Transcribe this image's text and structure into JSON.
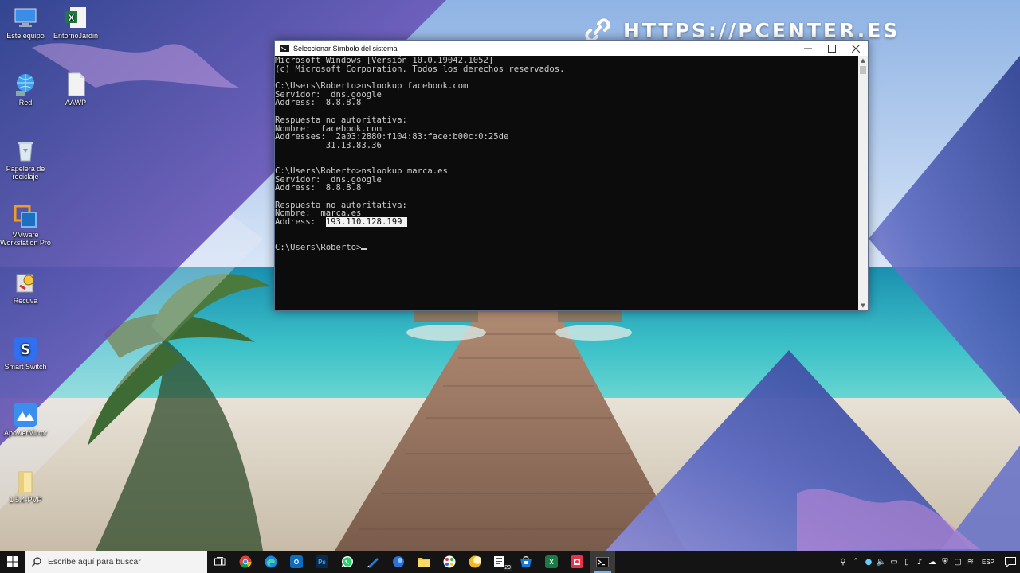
{
  "watermark": {
    "text": "HTTPS://PCENTER.ES"
  },
  "desktop_icons": [
    {
      "label": "Este equipo",
      "icon": "pc-icon"
    },
    {
      "label": "EntornoJardin",
      "icon": "excel-file-icon"
    },
    {
      "label": "Red",
      "icon": "network-icon"
    },
    {
      "label": "AAWP",
      "icon": "file-icon"
    },
    {
      "label": "Papelera de reciclaje",
      "icon": "recycle-bin-icon"
    },
    {
      "label": "VMware Workstation Pro",
      "icon": "vmware-icon"
    },
    {
      "label": "Recuva",
      "icon": "recuva-icon"
    },
    {
      "label": "Smart Switch",
      "icon": "smart-switch-icon"
    },
    {
      "label": "ApowerMirror",
      "icon": "apowermirror-icon"
    },
    {
      "label": "1.5.4-PVP",
      "icon": "folder-icon"
    }
  ],
  "cmd": {
    "title": "Seleccionar Símbolo del sistema",
    "lines": [
      "Microsoft Windows [Versión 10.0.19042.1052]",
      "(c) Microsoft Corporation. Todos los derechos reservados.",
      "",
      "C:\\Users\\Roberto>nslookup facebook.com",
      "Servidor:  dns.google",
      "Address:  8.8.8.8",
      "",
      "Respuesta no autoritativa:",
      "Nombre:  facebook.com",
      "Addresses:  2a03:2880:f104:83:face:b00c:0:25de",
      "          31.13.83.36",
      "",
      "",
      "C:\\Users\\Roberto>nslookup marca.es",
      "Servidor:  dns.google",
      "Address:  8.8.8.8",
      "",
      "Respuesta no autoritativa:",
      "Nombre:  marca.es"
    ],
    "address_label": "Address:  ",
    "selected_address": "193.110.128.199 ",
    "prompt": "C:\\Users\\Roberto>"
  },
  "taskbar": {
    "search_placeholder": "Escribe aquí para buscar",
    "apps": [
      {
        "name": "task-view-button",
        "icon": "task-view-icon"
      },
      {
        "name": "chrome-button",
        "icon": "chrome-icon"
      },
      {
        "name": "edge-button",
        "icon": "edge-icon"
      },
      {
        "name": "outlook-button",
        "icon": "outlook-icon",
        "text": "O",
        "color": "#0f6cbd"
      },
      {
        "name": "photoshop-button",
        "icon": "photoshop-icon",
        "text": "Ps",
        "color": "#0b2a4a"
      },
      {
        "name": "whatsapp-button",
        "icon": "whatsapp-icon"
      },
      {
        "name": "pen-app-button",
        "icon": "pen-icon"
      },
      {
        "name": "browser-button",
        "icon": "globe-icon"
      },
      {
        "name": "file-explorer-button",
        "icon": "folder-icon"
      },
      {
        "name": "paint-button",
        "icon": "palette-icon"
      },
      {
        "name": "app-button",
        "icon": "moon-icon"
      },
      {
        "name": "calendar-button",
        "icon": "calendar-icon",
        "badge": "29"
      },
      {
        "name": "store-button",
        "icon": "store-icon"
      },
      {
        "name": "excel-button",
        "icon": "excel-icon",
        "text": "X",
        "color": "#1e7a45"
      },
      {
        "name": "media-button",
        "icon": "media-icon"
      },
      {
        "name": "cmd-button",
        "icon": "cmd-icon"
      }
    ],
    "language": "ESP"
  },
  "colors": {
    "cmd_bg": "#0c0c0c",
    "cmd_text": "#cccccc",
    "taskbar_bg": "#141414",
    "accent": "#77b4f0"
  }
}
